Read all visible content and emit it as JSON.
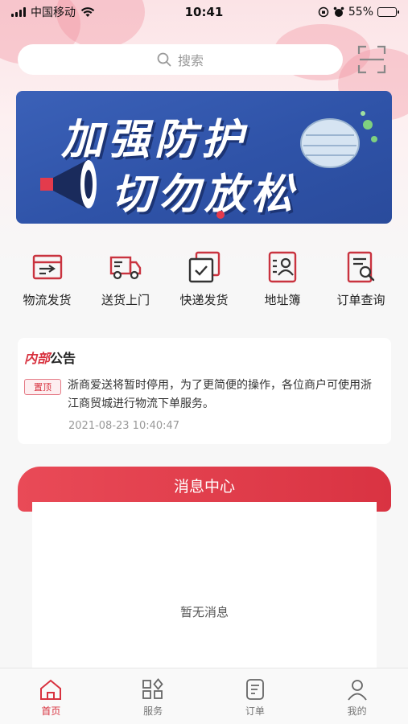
{
  "status_bar": {
    "carrier": "中国移动",
    "time": "10:41",
    "battery": "55%",
    "battery_level": 0.55
  },
  "search": {
    "placeholder": "搜索"
  },
  "banner": {
    "line1": "加强防护",
    "line2": "切勿放松"
  },
  "quick_menu": [
    {
      "label": "物流发货",
      "icon": "box-arrow-icon"
    },
    {
      "label": "送货上门",
      "icon": "truck-icon"
    },
    {
      "label": "快递发货",
      "icon": "checkbox-stack-icon"
    },
    {
      "label": "地址簿",
      "icon": "contact-book-icon"
    },
    {
      "label": "订单查询",
      "icon": "document-search-icon"
    }
  ],
  "notice": {
    "title_red": "内部",
    "title_dark": "公告",
    "tag": "置顶",
    "text": "浙商爱送将暂时停用，为了更简便的操作，各位商户可使用浙江商贸城进行物流下单服务。",
    "time": "2021-08-23 10:40:47"
  },
  "message_center": {
    "title": "消息中心",
    "empty": "暂无消息"
  },
  "tab_bar": [
    {
      "label": "首页",
      "icon": "home-icon",
      "active": true
    },
    {
      "label": "服务",
      "icon": "grid-icon",
      "active": false
    },
    {
      "label": "订单",
      "icon": "order-icon",
      "active": false
    },
    {
      "label": "我的",
      "icon": "user-icon",
      "active": false
    }
  ],
  "colors": {
    "accent": "#d8323f",
    "banner_blue": "#2f53a8"
  }
}
